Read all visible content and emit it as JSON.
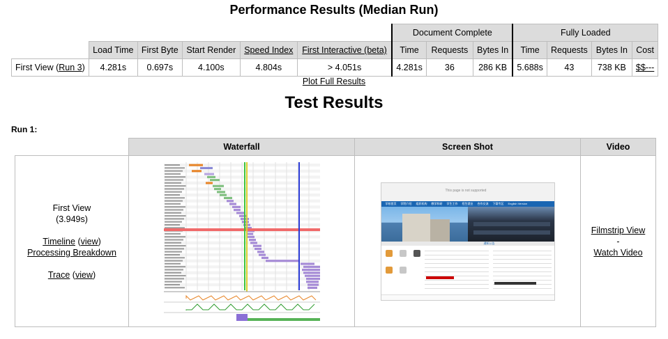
{
  "title": "Performance Results (Median Run)",
  "summary": {
    "group_document": "Document Complete",
    "group_fully": "Fully Loaded",
    "headers": [
      "Load Time",
      "First Byte",
      "Start Render",
      "Speed Index",
      "First Interactive (beta)",
      "Time",
      "Requests",
      "Bytes In",
      "Time",
      "Requests",
      "Bytes In",
      "Cost"
    ],
    "row_label": "First View (",
    "row_run_link": "Run 3",
    "row_label_end": ")",
    "values": [
      "4.281s",
      "0.697s",
      "4.100s",
      "4.804s",
      "> 4.051s",
      "4.281s",
      "36",
      "286 KB",
      "5.688s",
      "43",
      "738 KB",
      "$$---"
    ]
  },
  "plot_link": "Plot Full Results",
  "test_title": "Test Results",
  "run_label": "Run 1:",
  "tests": {
    "headers": [
      "Waterfall",
      "Screen Shot",
      "Video"
    ],
    "first_view": "First View",
    "first_view_time": "(3.949s)",
    "timeline": "Timeline",
    "view": "view",
    "processing": "Processing Breakdown",
    "trace": "Trace",
    "filmstrip": "Filmstrip View",
    "dash": "-",
    "watch_video": "Watch Video"
  },
  "screenshot": {
    "banner_text": "This page is not supported",
    "nav": [
      "学校首页",
      "学院介绍",
      "组织机构",
      "教学科研",
      "学生工作",
      "招生就业",
      "合作交流",
      "下载专区",
      "English Version"
    ],
    "section_title": "通知公告"
  }
}
